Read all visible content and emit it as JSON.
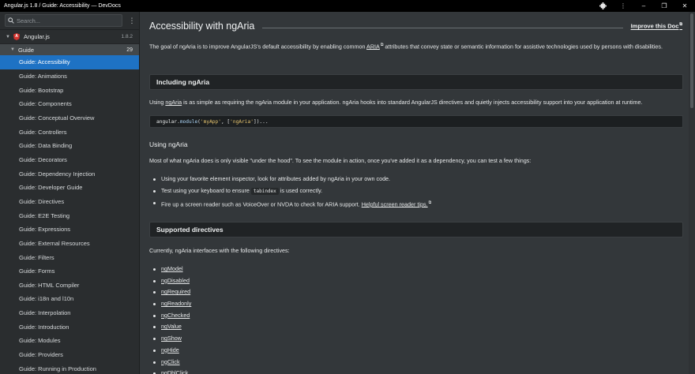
{
  "window": {
    "title": "Angular.js 1.8 / Guide: Accessibility — DevDocs"
  },
  "sidebar": {
    "search_placeholder": "Search...",
    "doc": {
      "name": "Angular.js",
      "version": "1.8.2"
    },
    "guide": {
      "label": "Guide",
      "count": "29"
    },
    "items": [
      "Guide: Accessibility",
      "Guide: Animations",
      "Guide: Bootstrap",
      "Guide: Components",
      "Guide: Conceptual Overview",
      "Guide: Controllers",
      "Guide: Data Binding",
      "Guide: Decorators",
      "Guide: Dependency Injection",
      "Guide: Developer Guide",
      "Guide: Directives",
      "Guide: E2E Testing",
      "Guide: Expressions",
      "Guide: External Resources",
      "Guide: Filters",
      "Guide: Forms",
      "Guide: HTML Compiler",
      "Guide: i18n and l10n",
      "Guide: Interpolation",
      "Guide: Introduction",
      "Guide: Modules",
      "Guide: Providers",
      "Guide: Running in Production"
    ]
  },
  "content": {
    "title": "Accessibility with ngAria",
    "improve_link": "Improve this Doc",
    "intro": {
      "before": "The goal of ngAria is to improve AngularJS's default accessibility by enabling common ",
      "link": "ARIA",
      "after": " attributes that convey state or semantic information for assistive technologies used by persons with disabilities."
    },
    "including_heading": "Including ngAria",
    "including_para": {
      "before": "Using ",
      "link": "ngAria",
      "after": " is as simple as requiring the ngAria module in your application. ngAria hooks into standard AngularJS directives and quietly injects accessibility support into your application at runtime."
    },
    "code": {
      "obj": "angular.",
      "fn": "module",
      "open": "(",
      "str1": "'myApp'",
      "mid": ", [",
      "str2": "'ngAria'",
      "close": "])..."
    },
    "using_heading": "Using ngAria",
    "using_para": "Most of what ngAria does is only visible \"under the hood\". To see the module in action, once you've added it as a dependency, you can test a few things:",
    "bullets": {
      "b1": "Using your favorite element inspector, look for attributes added by ngAria in your own code.",
      "b2_before": "Test using your keyboard to ensure ",
      "b2_code": "tabindex",
      "b2_after": " is used correctly.",
      "b3_before": "Fire up a screen reader such as VoiceOver or NVDA to check for ARIA support. ",
      "b3_link": "Helpful screen reader tips."
    },
    "supported_heading": "Supported directives",
    "supported_para": "Currently, ngAria interfaces with the following directives:",
    "directives": [
      "ngModel",
      "ngDisabled",
      "ngRequired",
      "ngReadonly",
      "ngChecked",
      "ngValue",
      "ngShow",
      "ngHide",
      "ngClick",
      "ngDblClick"
    ]
  }
}
